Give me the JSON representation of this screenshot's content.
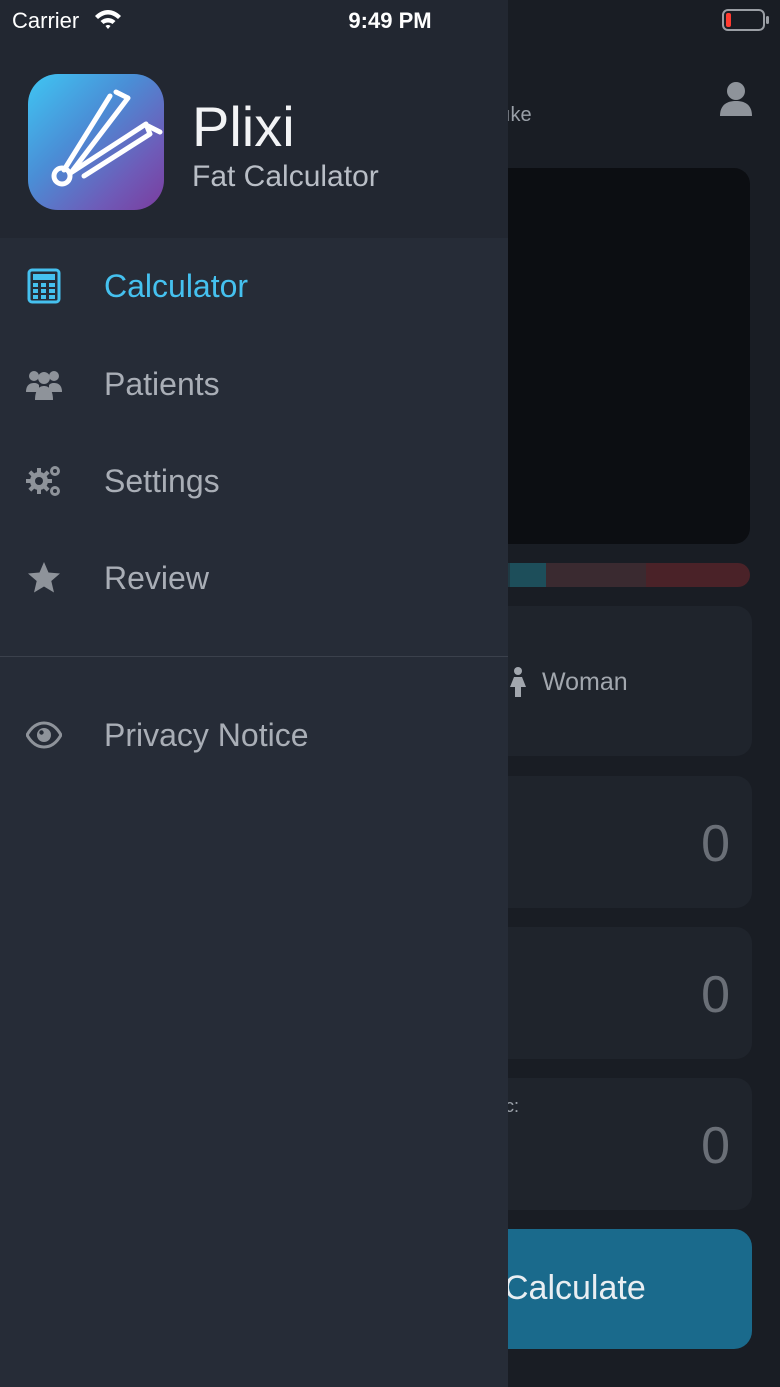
{
  "status_bar": {
    "carrier": "Carrier",
    "time": "9:49 PM",
    "battery_level": 0.15,
    "battery_color": "#ff3b30"
  },
  "drawer": {
    "app_name": "Plixi",
    "app_subtitle": "Fat Calculator",
    "items": [
      {
        "label": "Calculator",
        "icon": "calculator-icon",
        "active": true
      },
      {
        "label": "Patients",
        "icon": "users-icon",
        "active": false
      },
      {
        "label": "Settings",
        "icon": "gears-icon",
        "active": false
      },
      {
        "label": "Review",
        "icon": "star-icon",
        "active": false
      }
    ],
    "secondary_items": [
      {
        "label": "Privacy Notice",
        "icon": "eye-icon"
      }
    ],
    "colors": {
      "active": "#45c1ef",
      "inactive": "#a9aeb6",
      "background": "#262c37"
    }
  },
  "main": {
    "hint_text": "ıke",
    "gender_option": "Woman",
    "field_values": [
      "0",
      "0",
      "0"
    ],
    "field_caption": "c:",
    "calculate_label": "Calculate",
    "accent_color": "#1a6a8c"
  }
}
